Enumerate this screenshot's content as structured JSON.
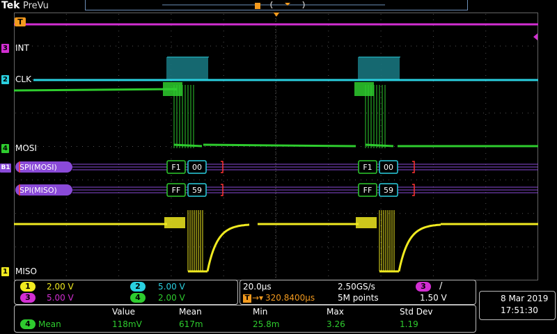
{
  "header": {
    "brand": "Tek",
    "mode": "PreVu"
  },
  "trigger": {
    "marker": "T"
  },
  "channels": [
    {
      "id": "3",
      "label": "INT",
      "color": "#d22ed2"
    },
    {
      "id": "2",
      "label": "CLK",
      "color": "#2ad0e0"
    },
    {
      "id": "4",
      "label": "MOSI",
      "color": "#2ecc2e"
    },
    {
      "id": "1",
      "label": "MISO",
      "color": "#f0ea20"
    }
  ],
  "bus": {
    "id": "B1",
    "rows": [
      {
        "label": "SPI(MOSI)"
      },
      {
        "label": "SPI(MISO)"
      }
    ]
  },
  "packets": [
    {
      "mosi": [
        "F1",
        "00"
      ],
      "miso": [
        "FF",
        "59"
      ]
    },
    {
      "mosi": [
        "F1",
        "00"
      ],
      "miso": [
        "FF",
        "59"
      ]
    }
  ],
  "scale": {
    "ch1": {
      "num": "1",
      "value": "2.00 V"
    },
    "ch2": {
      "num": "2",
      "value": "5.00 V"
    },
    "ch3": {
      "num": "3",
      "value": "5.00 V"
    },
    "ch4": {
      "num": "4",
      "value": "2.00 V"
    }
  },
  "timebase": {
    "horizontal": "20.0µs",
    "sample_rate": "2.50GS/s",
    "position": "320.8400µs",
    "record": "5M points",
    "trigger_source": "3",
    "trigger_level": "1.50 V",
    "trigger_slope": "/"
  },
  "datetime": {
    "date": "8 Mar  2019",
    "time": "17:51:30"
  },
  "measurement": {
    "channel": "4",
    "name": "Mean",
    "headers": [
      "Value",
      "Mean",
      "Min",
      "Max",
      "Std Dev"
    ],
    "values": [
      "118mV",
      "617m",
      "25.8m",
      "3.26",
      "1.19"
    ]
  },
  "colors": {
    "ch1": "#f0ea20",
    "ch2": "#2ad0e0",
    "ch3": "#d22ed2",
    "ch4": "#2ecc2e",
    "bus": "#8a4ad8"
  }
}
